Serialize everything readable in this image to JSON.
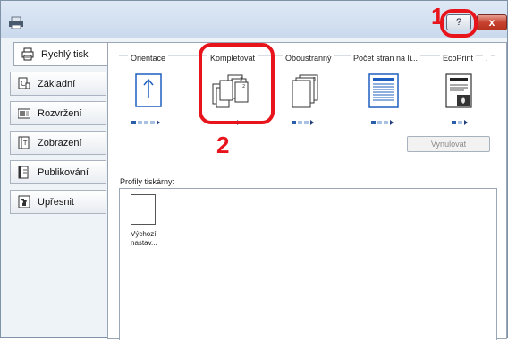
{
  "window": {
    "help_label": "?",
    "close_label": "x"
  },
  "callouts": [
    "1",
    "2"
  ],
  "sidebar": {
    "items": [
      {
        "label": "Rychlý tisk",
        "icon": "printer-icon",
        "active": true
      },
      {
        "label": "Základní",
        "icon": "basic-copies-icon"
      },
      {
        "label": "Rozvržení",
        "icon": "layout-icon"
      },
      {
        "label": "Zobrazení",
        "icon": "imaging-icon"
      },
      {
        "label": "Publikování",
        "icon": "publishing-icon"
      },
      {
        "label": "Upřesnit",
        "icon": "advanced-puzzle-icon"
      }
    ]
  },
  "quick_print": {
    "columns": [
      {
        "label": "Orientace",
        "icon": "portrait-orientation-icon"
      },
      {
        "label": "Kompletovat",
        "icon": "collate-icon"
      },
      {
        "label": "Oboustranný",
        "icon": "duplex-icon"
      },
      {
        "label": "Počet stran na li...",
        "icon": "pages-per-sheet-icon"
      },
      {
        "label": "EcoPrint",
        "icon": "ecoprint-icon"
      }
    ],
    "ellipsis": ".",
    "reset_label": "Vynulovat"
  },
  "profiles": {
    "label": "Profily tiskárny:",
    "items": [
      {
        "label": "Výchozí\nnastav..."
      }
    ]
  },
  "colors": {
    "callout_red": "#e8141b",
    "dot_blue": "#2a5ea8",
    "icon_blue": "#1f5fbf"
  }
}
